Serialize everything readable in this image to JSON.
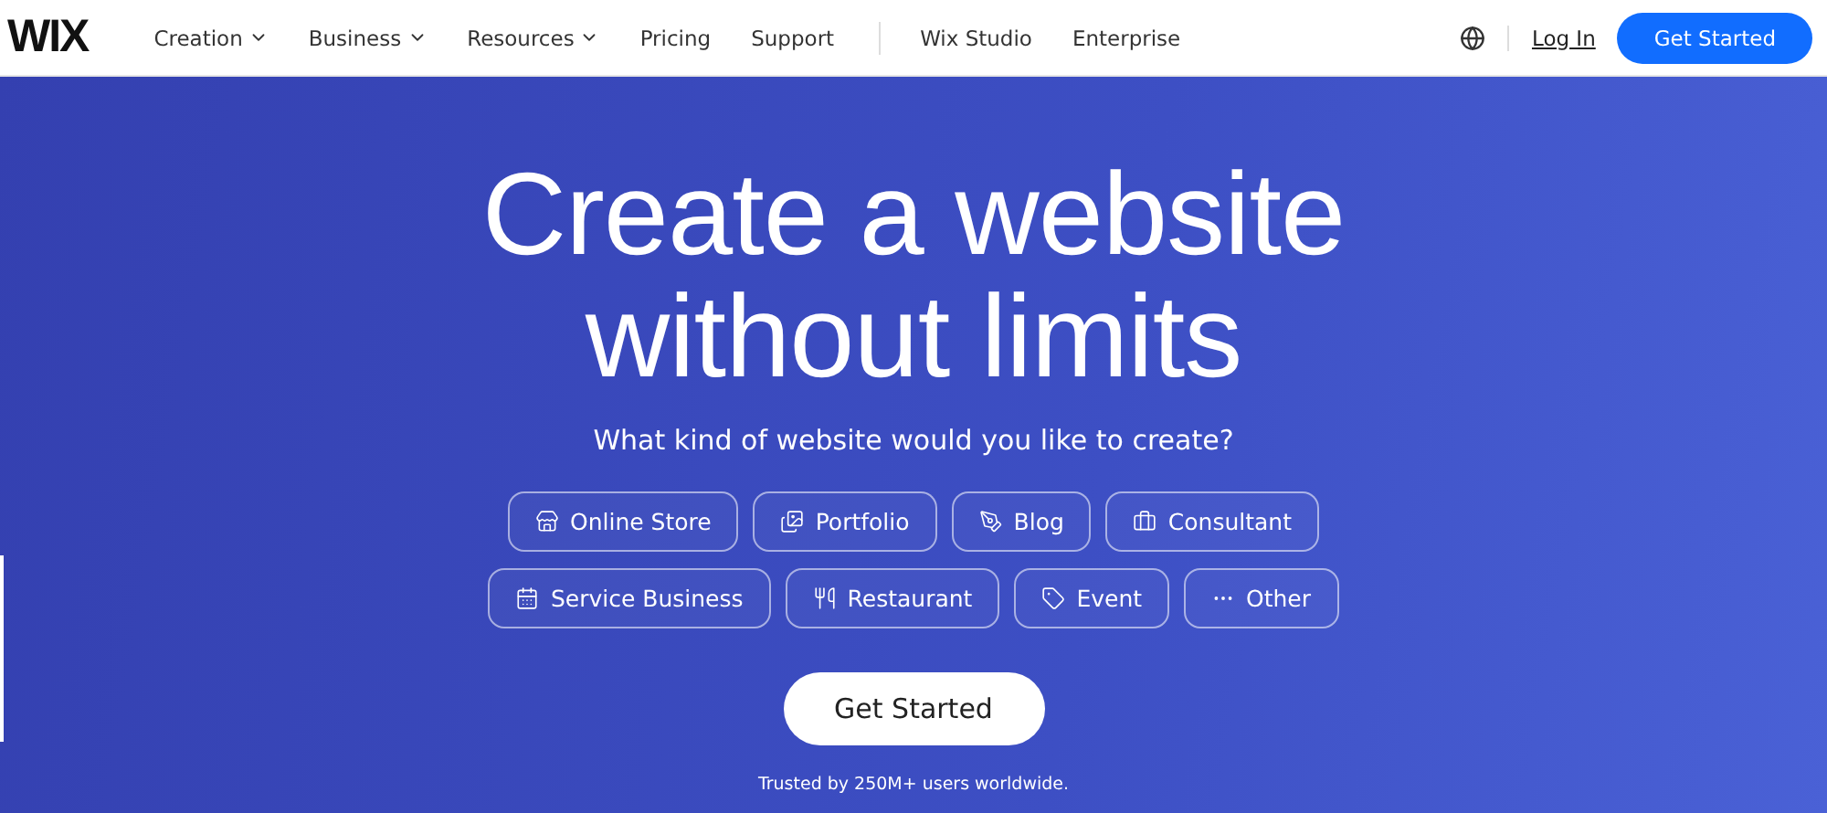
{
  "header": {
    "logo": "WIX",
    "nav": [
      {
        "label": "Creation",
        "has_menu": true
      },
      {
        "label": "Business",
        "has_menu": true
      },
      {
        "label": "Resources",
        "has_menu": true
      },
      {
        "label": "Pricing",
        "has_menu": false
      },
      {
        "label": "Support",
        "has_menu": false
      }
    ],
    "nav_secondary": [
      {
        "label": "Wix Studio"
      },
      {
        "label": "Enterprise"
      }
    ],
    "login": "Log In",
    "cta": "Get Started"
  },
  "hero": {
    "title_lines": [
      "Create a website",
      "without limits"
    ],
    "question": "What kind of website would you like to create?",
    "categories": [
      [
        "Online Store",
        "Portfolio",
        "Blog",
        "Consultant"
      ],
      [
        "Service Business",
        "Restaurant",
        "Event",
        "Other"
      ]
    ],
    "cta": "Get Started",
    "trust": "Trusted by 250M+ users worldwide."
  }
}
